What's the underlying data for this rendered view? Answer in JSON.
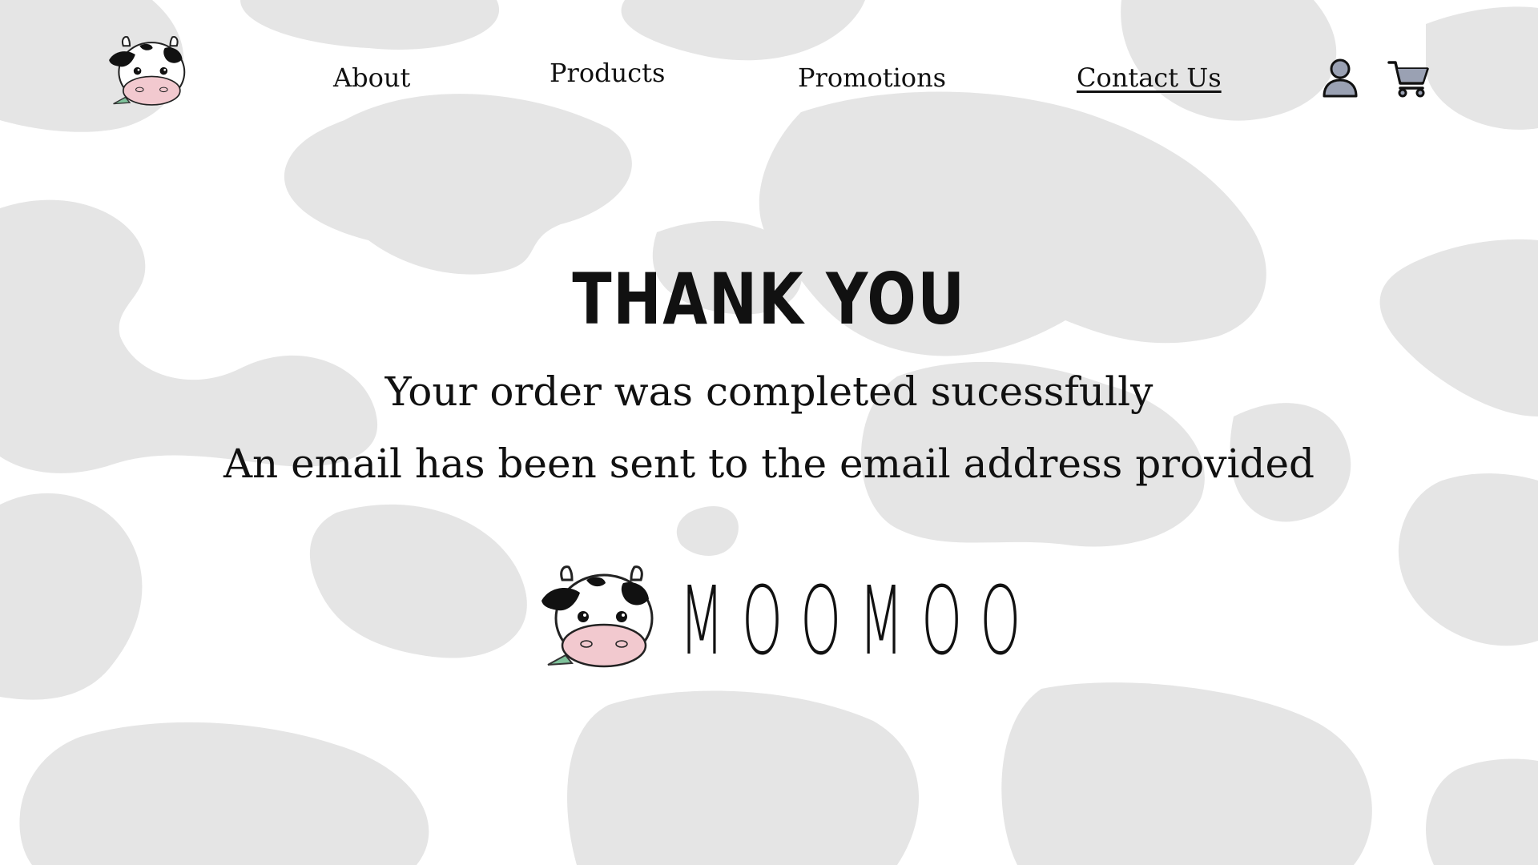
{
  "nav": {
    "logo_icon": "cow-head-icon",
    "links": [
      "About",
      "Products",
      "Promotions",
      "Contact Us"
    ],
    "active": "Contact Us",
    "user_icon": "user-icon",
    "cart_icon": "shopping-cart-icon"
  },
  "confirmation": {
    "heading": "THANK YOU",
    "line1": "Your order was completed sucessfully",
    "line2": "An email has been sent to the email address provided"
  },
  "brand": {
    "logo_icon": "cow-head-icon",
    "name": "MOOMOO"
  },
  "colors": {
    "background": "#ffffff",
    "cow_spots": "#e5e5e5",
    "text": "#111111",
    "icon_fill": "#9aa1b3",
    "cow_muzzle": "#f2c9cf",
    "leaf": "#7fc29b"
  }
}
